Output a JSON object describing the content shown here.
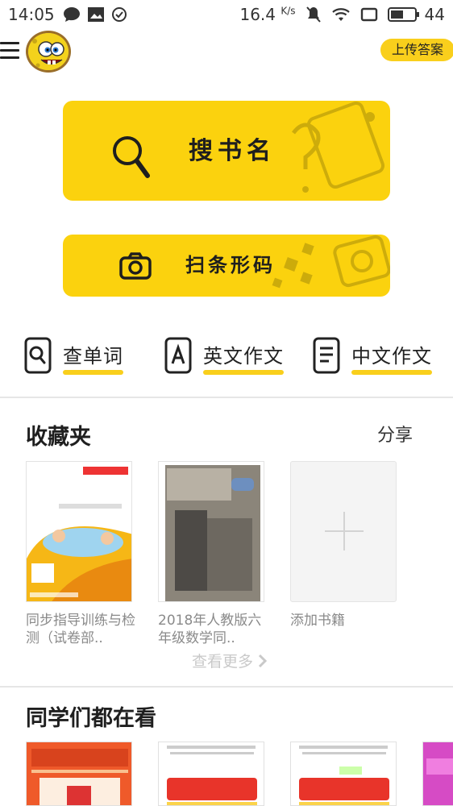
{
  "status": {
    "time": "14:05",
    "speed": "16.4",
    "speed_unit": "K/s",
    "battery": "44"
  },
  "header": {
    "upload_label": "上传答案"
  },
  "actions": {
    "search_label": "搜书名",
    "scan_label": "扫条形码"
  },
  "tools": [
    {
      "label": "查单词",
      "icon": "magnifier-box-icon"
    },
    {
      "label": "英文作文",
      "icon": "letter-a-box-icon"
    },
    {
      "label": "中文作文",
      "icon": "document-lines-icon"
    }
  ],
  "favorites": {
    "title": "收藏夹",
    "share_label": "分享",
    "books": [
      {
        "title": "同步指导训练与检测（试卷部.."
      },
      {
        "title": "2018年人教版六年级数学同.."
      }
    ],
    "add_label": "添加书籍",
    "more_label": "查看更多"
  },
  "popular": {
    "title": "同学们都在看"
  },
  "colors": {
    "accent": "#fbd20e",
    "text": "#222222",
    "muted": "#8a8a8a"
  }
}
